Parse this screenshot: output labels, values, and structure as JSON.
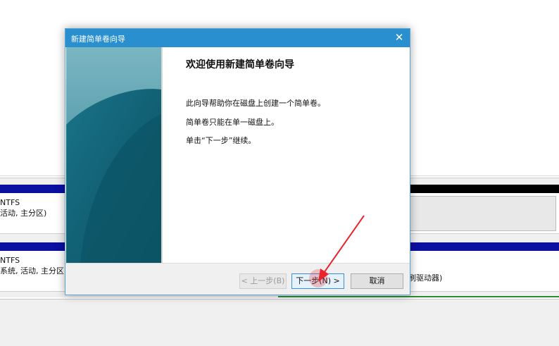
{
  "background": {
    "disk0": {
      "line1": "NTFS",
      "line2": "活动, 主分区)"
    },
    "disk1": {
      "line1": "NTFS",
      "line2": "系统, 活动, 主分区)",
      "drive_text": "刷驱动器)"
    }
  },
  "dialog": {
    "title": "新建简单卷向导",
    "close_glyph": "✕",
    "heading": "欢迎使用新建简单卷向导",
    "paragraphs": [
      "此向导帮助你在磁盘上创建一个简单卷。",
      "简单卷只能在单一磁盘上。",
      "单击“下一步”继续。"
    ],
    "buttons": {
      "back": "< 上一步(B)",
      "next": "下一步(N) >",
      "cancel": "取消"
    },
    "back_enabled": false
  },
  "colors": {
    "titlebar": "#2a8fcf",
    "side_art": "#0f5f73",
    "disk_bar": "#0b10a0",
    "annotation": "#e8242c"
  }
}
